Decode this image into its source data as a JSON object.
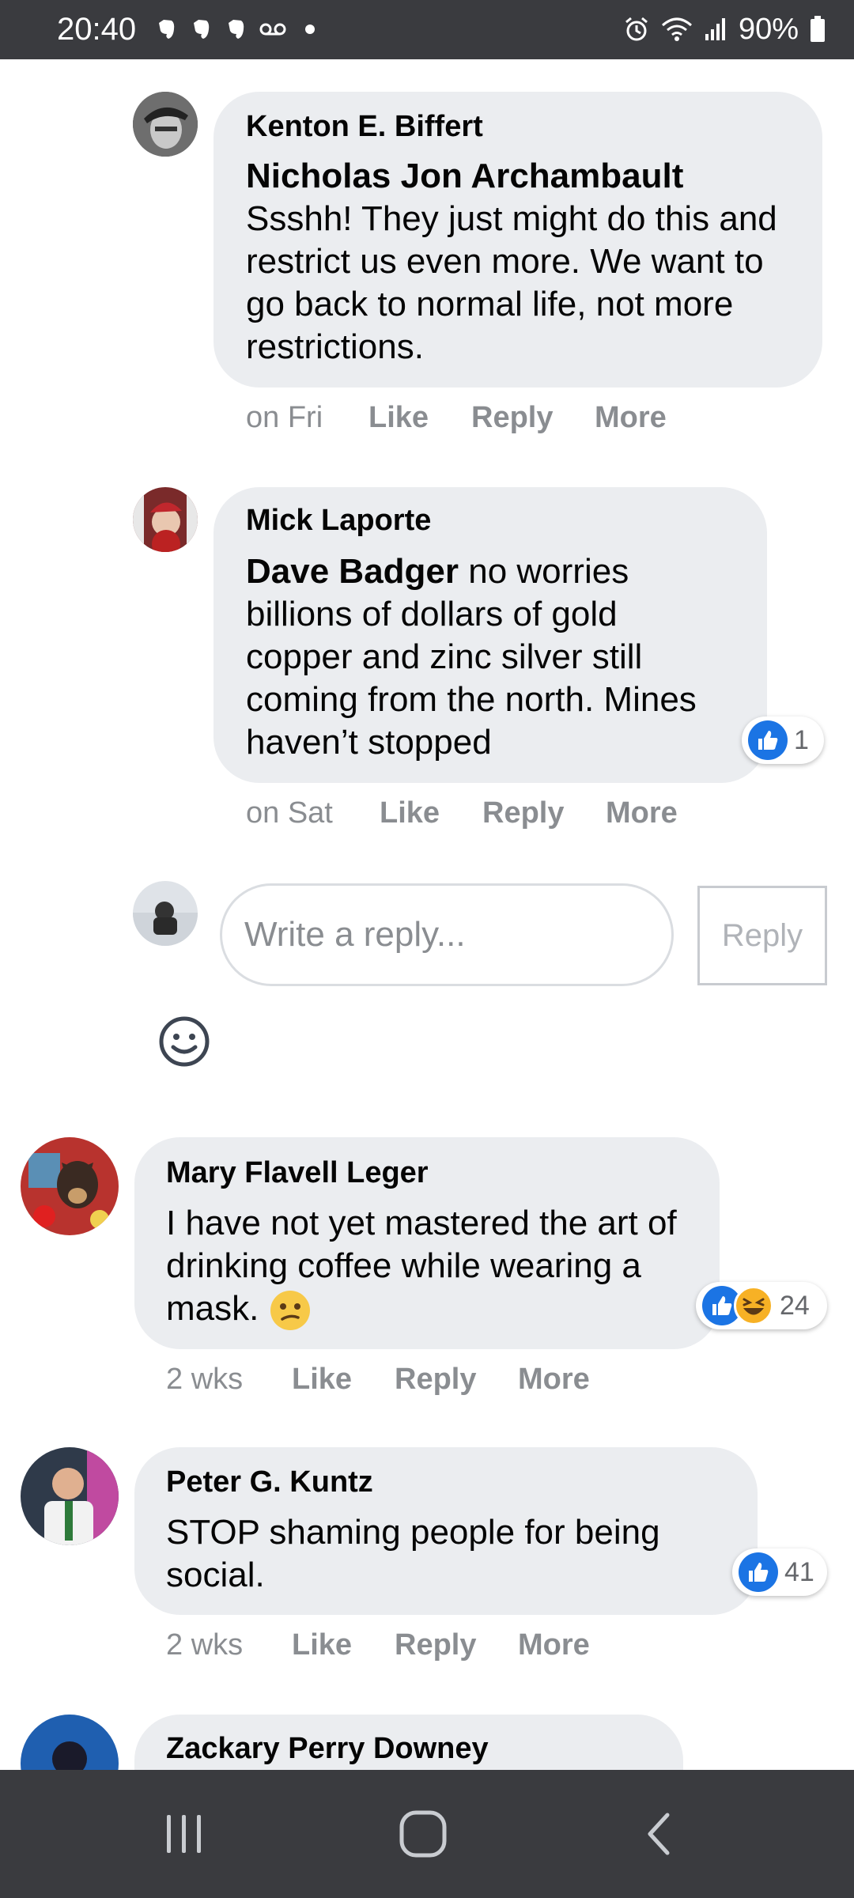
{
  "status_bar": {
    "time": "20:40",
    "battery": "90%",
    "notification_icons": [
      "evernote-icon",
      "evernote-icon",
      "evernote-icon",
      "voicemail-icon",
      "dot-icon"
    ],
    "system_icons": [
      "alarm-icon",
      "wifi-icon",
      "signal-icon",
      "battery-icon"
    ]
  },
  "comments": [
    {
      "author": "Kenton E. Biffert",
      "mention": "Nicholas Jon Archambault",
      "text": "Ssshh! They just might do this and restrict us even more. We want to go back to normal life, not more restrictions.",
      "time": "on Fri",
      "like": "Like",
      "reply": "Reply",
      "more": "More"
    },
    {
      "author": "Mick Laporte",
      "mention": "Dave Badger",
      "text": " no worries billions of dollars of gold copper and zinc silver still coming from the north. Mines haven’t stopped",
      "time": "on Sat",
      "like": "Like",
      "reply": "Reply",
      "more": "More",
      "reactions": {
        "count": "1",
        "types": [
          "like"
        ]
      }
    },
    {
      "author": "Mary Flavell Leger",
      "text": "I have not yet mastered the art of drinking coffee while wearing a mask. ",
      "emoji": "confused-face-emoji",
      "time": "2 wks",
      "like": "Like",
      "reply": "Reply",
      "more": "More",
      "reactions": {
        "count": "24",
        "types": [
          "like",
          "haha"
        ]
      }
    },
    {
      "author": "Peter G. Kuntz",
      "text": "STOP shaming people for being social.",
      "time": "2 wks",
      "like": "Like",
      "reply": "Reply",
      "more": "More",
      "reactions": {
        "count": "41",
        "types": [
          "like"
        ]
      }
    },
    {
      "author": "Zackary Perry Downey"
    }
  ],
  "reply_box": {
    "placeholder": "Write a reply...",
    "button": "Reply"
  },
  "colors": {
    "bubble": "#ebedf0",
    "like_blue": "#1b74e4",
    "meta_gray": "#8a8d91",
    "system_bar": "#3a3b3f"
  }
}
